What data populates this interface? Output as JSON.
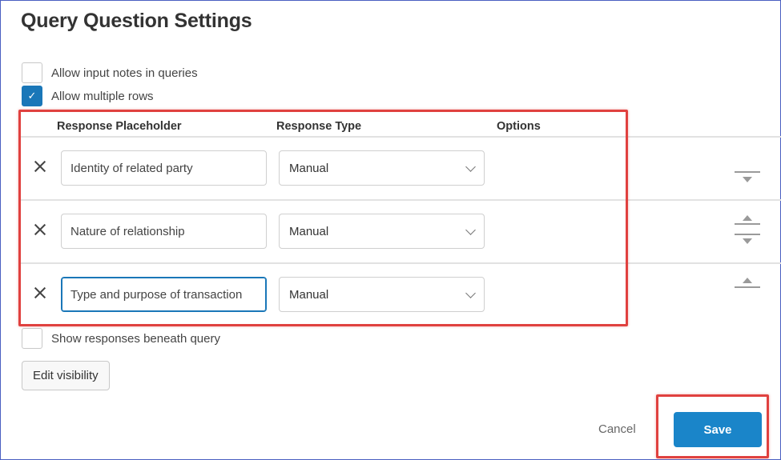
{
  "dialog": {
    "title": "Query Question Settings"
  },
  "options": {
    "allow_input_notes": {
      "label": "Allow input notes in queries",
      "checked": false
    },
    "allow_multiple_rows": {
      "label": "Allow multiple rows",
      "checked": true,
      "check_mark": "✓"
    },
    "show_responses_beneath": {
      "label": "Show responses beneath query",
      "checked": false
    }
  },
  "table": {
    "headers": {
      "placeholder": "Response Placeholder",
      "type": "Response Type",
      "options": "Options"
    },
    "rows": [
      {
        "placeholder": "Identity of related party",
        "type": "Manual"
      },
      {
        "placeholder": "Nature of relationship",
        "type": "Manual"
      },
      {
        "placeholder": "Type and purpose of transaction",
        "type": "Manual"
      }
    ]
  },
  "buttons": {
    "edit_visibility": "Edit visibility",
    "cancel": "Cancel",
    "save": "Save"
  },
  "colors": {
    "accent": "#1a85c9",
    "highlight": "#e0413f",
    "frame": "#4a5fc1"
  },
  "icons": {
    "remove": "close-icon",
    "move_down": "move-down-icon",
    "move_up": "move-up-icon",
    "dropdown": "chevron-down-icon"
  }
}
